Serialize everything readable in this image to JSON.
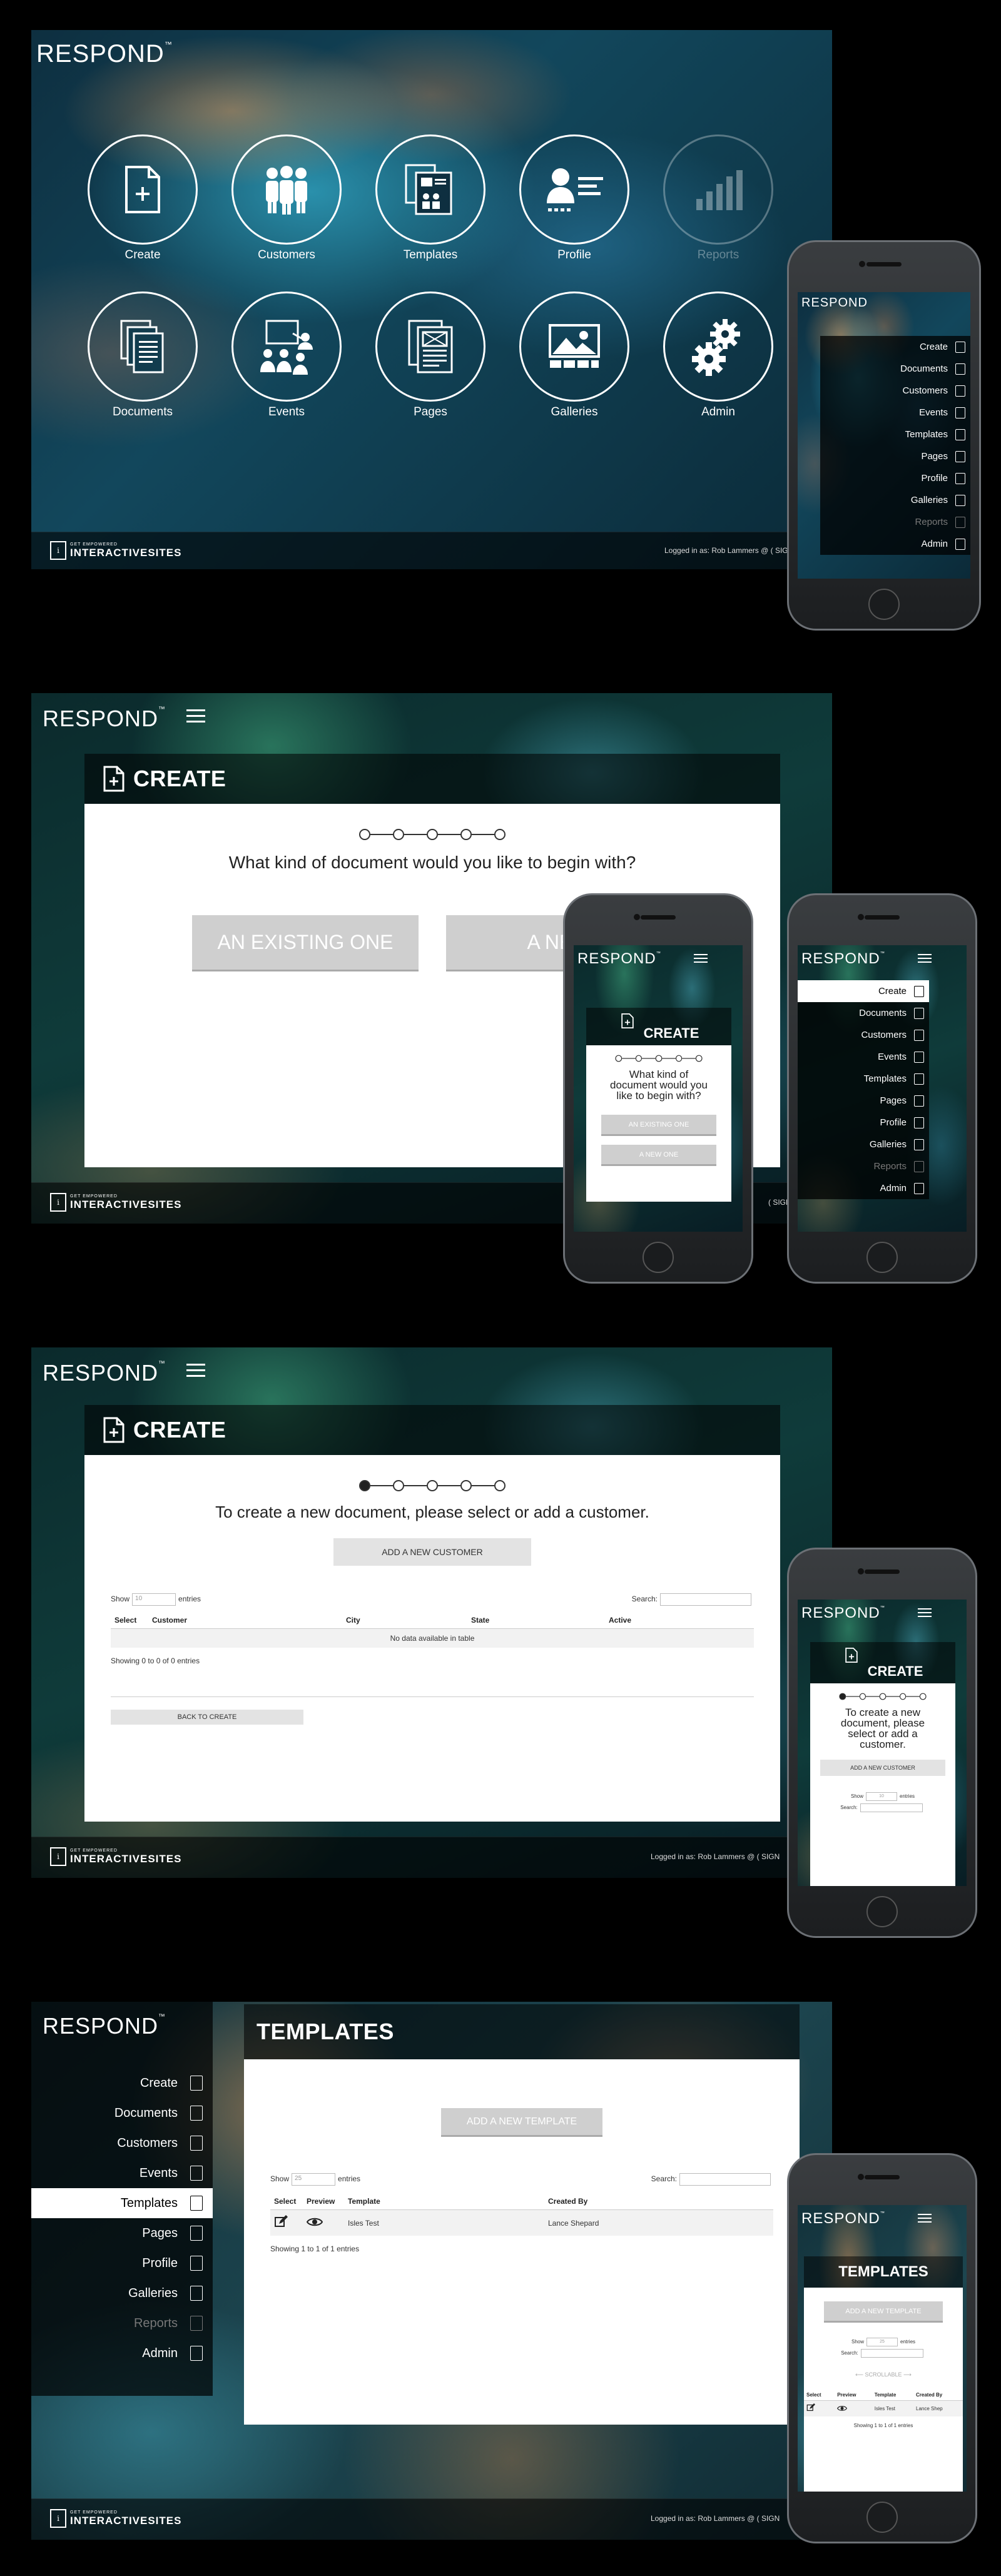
{
  "brand": "RESPOND",
  "brand_tm": "™",
  "footer": {
    "company_small": "GET EMPOWERED",
    "company": "INTERACTIVESITES",
    "logged_in": "Logged in as: Rob Lammers @",
    "sign": "( SIGN",
    "mark": "i"
  },
  "home": {
    "tiles": [
      {
        "label": "Create"
      },
      {
        "label": "Customers"
      },
      {
        "label": "Templates"
      },
      {
        "label": "Profile"
      },
      {
        "label": "Reports"
      },
      {
        "label": "Documents"
      },
      {
        "label": "Events"
      },
      {
        "label": "Pages"
      },
      {
        "label": "Galleries"
      },
      {
        "label": "Admin"
      }
    ]
  },
  "menu": {
    "items": [
      {
        "label": "Create"
      },
      {
        "label": "Documents"
      },
      {
        "label": "Customers"
      },
      {
        "label": "Events"
      },
      {
        "label": "Templates"
      },
      {
        "label": "Pages"
      },
      {
        "label": "Profile"
      },
      {
        "label": "Galleries"
      },
      {
        "label": "Reports"
      },
      {
        "label": "Admin"
      }
    ]
  },
  "create1": {
    "title": "CREATE",
    "question": "What kind of document would you like to begin with?",
    "question_m1": "What kind of",
    "question_m2": "document would you",
    "question_m3": "like to begin with?",
    "btn_existing": "AN EXISTING ONE",
    "btn_new_partial": "A NEW",
    "btn_new": "A NEW ONE",
    "step": 0
  },
  "create2": {
    "title": "CREATE",
    "prompt": "To create a new document, please select or add a customer.",
    "prompt_m1": "To create a new",
    "prompt_m2": "document, please",
    "prompt_m3": "select or add a",
    "prompt_m4": "customer.",
    "add_btn": "ADD A NEW CUSTOMER",
    "show": "Show",
    "show_val": "10",
    "entries": "entries",
    "search": "Search:",
    "columns": [
      "Select",
      "Customer",
      "City",
      "State",
      "Active"
    ],
    "empty": "No data available in table",
    "showing": "Showing 0 to 0 of 0 entries",
    "back": "BACK TO CREATE",
    "step": 1
  },
  "templates": {
    "title": "TEMPLATES",
    "add_btn": "ADD A NEW TEMPLATE",
    "show": "Show",
    "show_val": "25",
    "entries": "entries",
    "search": "Search:",
    "columns": [
      "Select",
      "Preview",
      "Template",
      "Created By"
    ],
    "rows": [
      {
        "template": "Isles Test",
        "created_by": "Lance Shepard"
      }
    ],
    "showing": "Showing 1 to 1 of 1 entries",
    "scroll_hint": "SCROLLABLE",
    "m_created_by": "Lance Shep",
    "m_columns": [
      "Select",
      "Preview",
      "Template",
      "Created By"
    ]
  },
  "colors": {
    "background": "#000000",
    "panel": "#ffffff",
    "button_gray": "#cfcfcf"
  }
}
